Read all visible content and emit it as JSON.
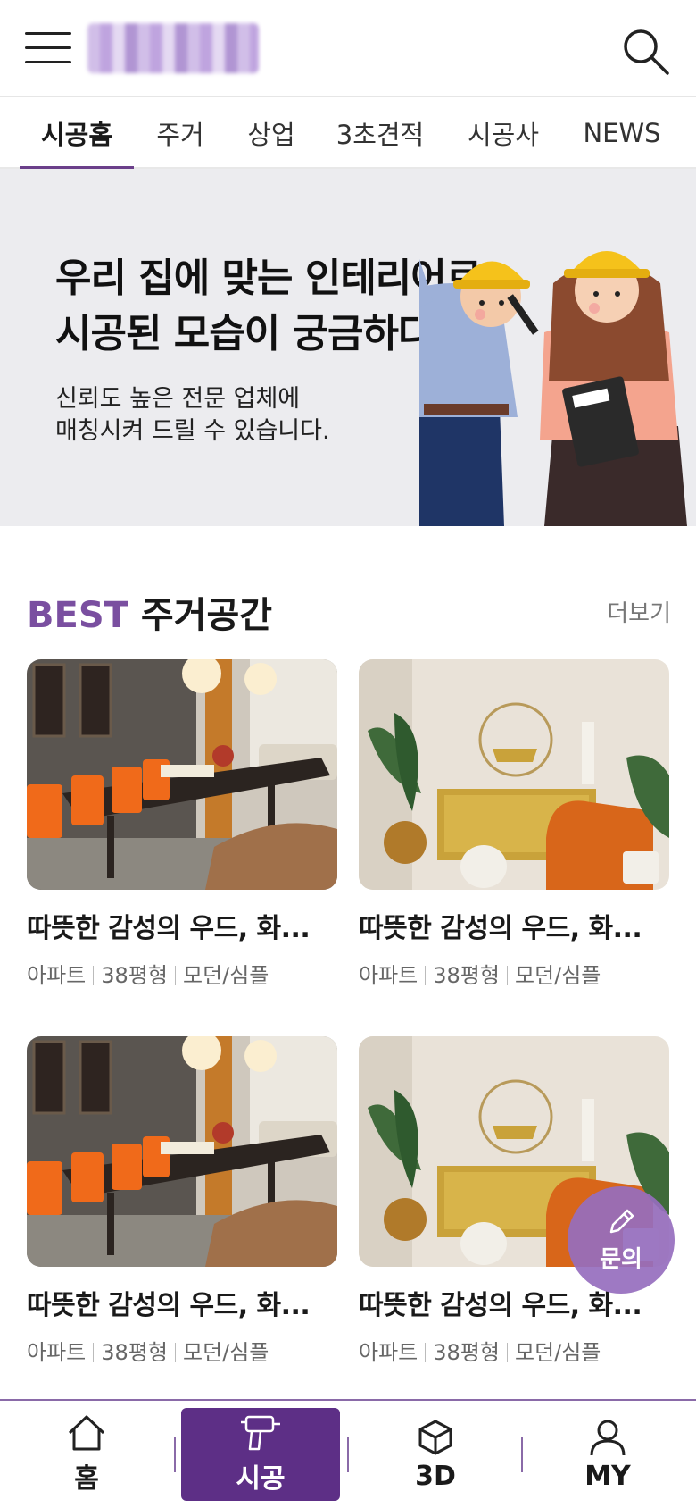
{
  "header": {
    "menu_icon": "hamburger-menu-icon",
    "search_icon": "search-icon"
  },
  "tabs": [
    {
      "label": "시공홈",
      "active": true
    },
    {
      "label": "주거",
      "active": false
    },
    {
      "label": "상업",
      "active": false
    },
    {
      "label": "3초견적",
      "active": false
    },
    {
      "label": "시공사",
      "active": false
    },
    {
      "label": "NEWS",
      "active": false
    }
  ],
  "banner": {
    "title_line1": "우리 집에 맞는 인테리어로",
    "title_line2": "시공된 모습이 궁금하다면?",
    "sub_line1": "신뢰도 높은 전문 업체에",
    "sub_line2": "매칭시켜 드릴 수 있습니다."
  },
  "section": {
    "title_accent": "BEST",
    "title_rest": "주거공간",
    "more": "더보기"
  },
  "cards": [
    {
      "title": "따뜻한 감성의 우드, 화...",
      "meta": [
        "아파트",
        "38평형",
        "모던/심플"
      ],
      "image": "dining-room"
    },
    {
      "title": "따뜻한 감성의 우드, 화...",
      "meta": [
        "아파트",
        "38평형",
        "모던/심플"
      ],
      "image": "living-room"
    },
    {
      "title": "따뜻한 감성의 우드, 화...",
      "meta": [
        "아파트",
        "38평형",
        "모던/심플"
      ],
      "image": "dining-room"
    },
    {
      "title": "따뜻한 감성의 우드, 화...",
      "meta": [
        "아파트",
        "38평형",
        "모던/심플"
      ],
      "image": "living-room"
    }
  ],
  "fab": {
    "label": "문의",
    "icon": "pencil-icon"
  },
  "bottom_nav": [
    {
      "label": "홈",
      "icon": "home-icon",
      "active": false
    },
    {
      "label": "시공",
      "icon": "drill-icon",
      "active": true
    },
    {
      "label": "3D",
      "icon": "cube-icon",
      "active": false
    },
    {
      "label": "MY",
      "icon": "user-icon",
      "active": false
    }
  ],
  "colors": {
    "accent": "#7a4fa0",
    "nav_active": "#5d2f86",
    "fab": "#966ebe"
  }
}
